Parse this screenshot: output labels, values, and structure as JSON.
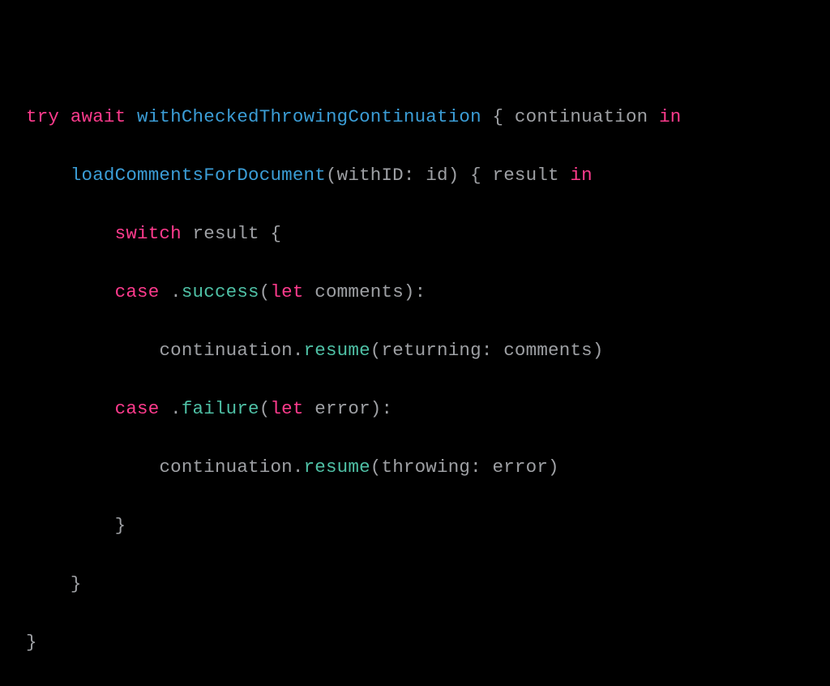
{
  "tokens": {
    "try": "try",
    "await": "await",
    "withCheckedThrowingContinuation": "withCheckedThrowingContinuation",
    "continuation": "continuation",
    "in": "in",
    "loadCommentsForDocument": "loadCommentsForDocument",
    "withID": "withID",
    "id": "id",
    "result": "result",
    "switch": "switch",
    "case": "case",
    "success": "success",
    "let": "let",
    "comments": "comments",
    "resume": "resume",
    "returning": "returning",
    "failure": "failure",
    "error": "error",
    "throwing": "throwing",
    "open_brace": "{",
    "close_brace": "}",
    "open_paren": "(",
    "close_paren": ")",
    "colon": ":",
    "dot": ".",
    "space": " "
  },
  "indent": {
    "i0": "",
    "i1": "    ",
    "i2": "        ",
    "i3": "            "
  }
}
